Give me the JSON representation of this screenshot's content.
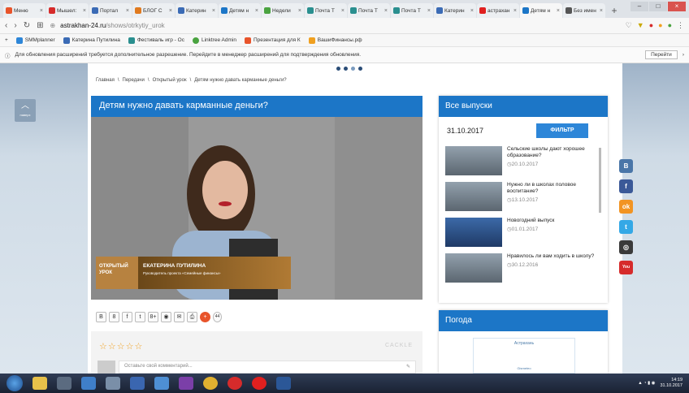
{
  "browser": {
    "tabs": [
      {
        "label": "Меню",
        "color": "#e8542b"
      },
      {
        "label": "Мышел:",
        "color": "#d62b2b"
      },
      {
        "label": "Портал",
        "color": "#3b6bb5"
      },
      {
        "label": "БЛОГ С",
        "color": "#e07a1f"
      },
      {
        "label": "Катерин",
        "color": "#3b6bb5"
      },
      {
        "label": "Детям н",
        "color": "#1c76c7"
      },
      {
        "label": "Недели",
        "color": "#4aa340"
      },
      {
        "label": "Почта Т",
        "color": "#2a8f8f"
      },
      {
        "label": "Почта Т",
        "color": "#2a8f8f"
      },
      {
        "label": "Почта Т",
        "color": "#2a8f8f"
      },
      {
        "label": "Катерин",
        "color": "#3b6bb5"
      },
      {
        "label": "астрахан",
        "color": "#e0201f"
      },
      {
        "label": "Детям н",
        "color": "#1c76c7",
        "active": true
      },
      {
        "label": "Без имен",
        "color": "#555555"
      }
    ],
    "url_host": "astrakhan-24.ru",
    "url_path": "/shows/otrkytiy_urok",
    "bookmarks": [
      "SMMplanner",
      "Катерина Путилина",
      "Фестиваль игр - Ос",
      "Linktree Admin",
      "Презентация для К",
      "ВашиФинансы.рф"
    ],
    "infobar_text": "Для обновления расширений требуется дополнительное разрешение. Перейдите в менеджер расширений для подтверждения обновления.",
    "infobar_button": "Перейти"
  },
  "breadcrumb": [
    "Главная",
    "Передачи",
    "Открытый урок",
    "Детям нужно давать карманные деньги?"
  ],
  "breadcrumb_sep": "\\",
  "left_handle": {
    "arrow": "︿",
    "caption": "наверх"
  },
  "video": {
    "title": "Детям нужно давать карманные деньги?",
    "lower_third_tag": "ОТКРЫТЫЙ УРОК",
    "speaker_name": "ЕКАТЕРИНА ПУТИЛИНА",
    "speaker_role": "Руководитель проекта «Семейные финансы»"
  },
  "share_icons": [
    "В",
    "8",
    "f",
    "t",
    "8+",
    "◉",
    "✉",
    "⎙",
    "+",
    "44"
  ],
  "comments": {
    "stars": "☆☆☆☆☆",
    "brand": "CACKLE",
    "placeholder": "Оставьте свой комментарий..."
  },
  "episodes": {
    "header": "Все выпуски",
    "date_value": "31.10.2017",
    "filter_label": "ФИЛЬТР",
    "items": [
      {
        "title": "Сельские школы дают хорошее образование?",
        "date": "20.10.2017"
      },
      {
        "title": "Нужно ли в школах половое воспитание?",
        "date": "13.10.2017"
      },
      {
        "title": "Новогодний выпуск",
        "date": "01.01.2017"
      },
      {
        "title": "Нравилось ли вам ходить в школу?",
        "date": "30.12.2016"
      }
    ]
  },
  "weather": {
    "header": "Погода",
    "city": "Астрахань",
    "source": "Gismeteo"
  },
  "social": [
    {
      "name": "vk",
      "glyph": "B",
      "color": "#4a76a8"
    },
    {
      "name": "facebook",
      "glyph": "f",
      "color": "#3b5998"
    },
    {
      "name": "odnoklassniki",
      "glyph": "ok",
      "color": "#f29423"
    },
    {
      "name": "twitter",
      "glyph": "t",
      "color": "#34a8e6"
    },
    {
      "name": "instagram",
      "glyph": "◎",
      "color": "#3a3a3a"
    },
    {
      "name": "youtube",
      "glyph": "You",
      "color": "#d62b2b"
    }
  ],
  "taskbar": {
    "time": "14:19",
    "date": "31.10.2017"
  }
}
